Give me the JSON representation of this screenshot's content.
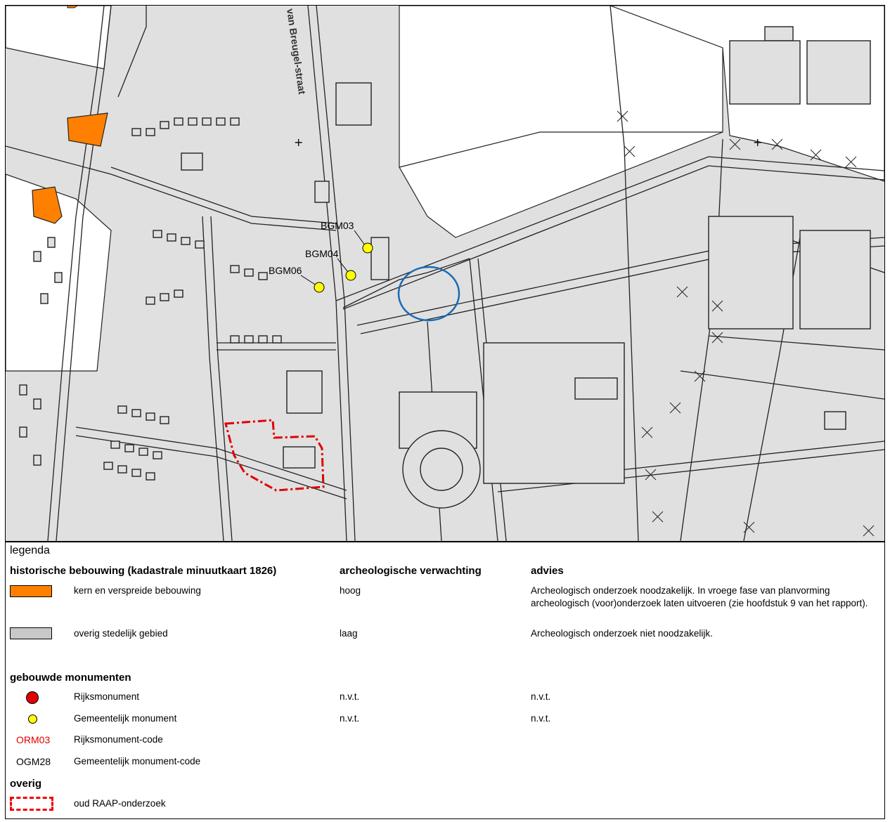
{
  "map": {
    "street_label": "van Breugel-straat",
    "monument_labels": [
      "BGM03",
      "BGM04",
      "BGM06"
    ],
    "colors": {
      "urban_fill": "#e0e0e0",
      "historic_fill": "#ff8000",
      "monument_yellow": "#ffff00",
      "project_circle": "#1a6ab5",
      "raap_outline": "#e00000"
    }
  },
  "legend": {
    "title": "legenda",
    "headers": {
      "historic": "historische bebouwing (kadastrale minuutkaart 1826)",
      "expectation": "archeologische verwachting",
      "advice": "advies"
    },
    "rows": [
      {
        "label": "kern en verspreide bebouwing",
        "expectation": "hoog",
        "advice_line1": "Archeologisch onderzoek noodzakelijk. In vroege fase van planvorming",
        "advice_line2": "archeologisch (voor)onderzoek laten uitvoeren (zie hoofdstuk 9 van het rapport)."
      },
      {
        "label": "overig stedelijk gebied",
        "expectation": "laag",
        "advice_line1": "Archeologisch onderzoek niet noodzakelijk."
      }
    ],
    "monuments_header": "gebouwde monumenten",
    "monuments": [
      {
        "label": "Rijksmonument",
        "expectation": "n.v.t.",
        "advice": "n.v.t."
      },
      {
        "label": "Gemeentelijk monument",
        "expectation": "n.v.t.",
        "advice": "n.v.t."
      }
    ],
    "codes": [
      {
        "code": "ORM03",
        "label": "Rijksmonument-code"
      },
      {
        "code": "OGM28",
        "label": "Gemeentelijk monument-code"
      }
    ],
    "other_header": "overig",
    "other": [
      {
        "label": "oud RAAP-onderzoek"
      }
    ]
  }
}
